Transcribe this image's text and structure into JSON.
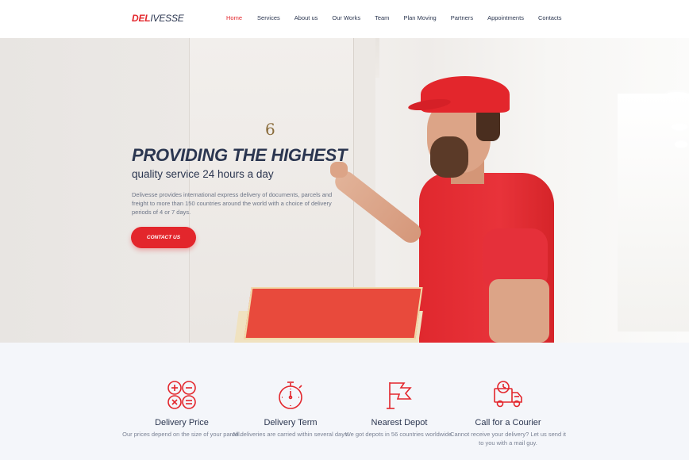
{
  "brand": {
    "logo_accent": "DEL",
    "logo_rest": "IVESSE",
    "accent_color": "#e3262c",
    "text_color": "#2b3650"
  },
  "nav": {
    "items": [
      {
        "label": "Home",
        "active": true
      },
      {
        "label": "Services"
      },
      {
        "label": "About us"
      },
      {
        "label": "Our Works"
      },
      {
        "label": "Team"
      },
      {
        "label": "Plan Moving"
      },
      {
        "label": "Partners"
      },
      {
        "label": "Appointments"
      },
      {
        "label": "Contacts"
      }
    ]
  },
  "hero": {
    "door_number": "6",
    "title": "PROVIDING THE HIGHEST",
    "subtitle": "quality service 24 hours a day",
    "description": "Delivesse provides international express delivery of documents, parcels and freight to more than 150 countries around the world with a choice of delivery periods of 4 or 7 days.",
    "cta_label": "CONTACT US"
  },
  "features": [
    {
      "icon": "calculator-icon",
      "title": "Delivery Price",
      "description": "Our prices depend on the size of your parcel."
    },
    {
      "icon": "stopwatch-icon",
      "title": "Delivery Term",
      "description": "All deliveries are carried within several days."
    },
    {
      "icon": "flag-icon",
      "title": "Nearest Depot",
      "description": "We got depots in 56 countries worldwide."
    },
    {
      "icon": "delivery-truck-icon",
      "title": "Call for a Courier",
      "description": "Cannot receive your delivery? Let us send it to you with a mail guy."
    }
  ]
}
